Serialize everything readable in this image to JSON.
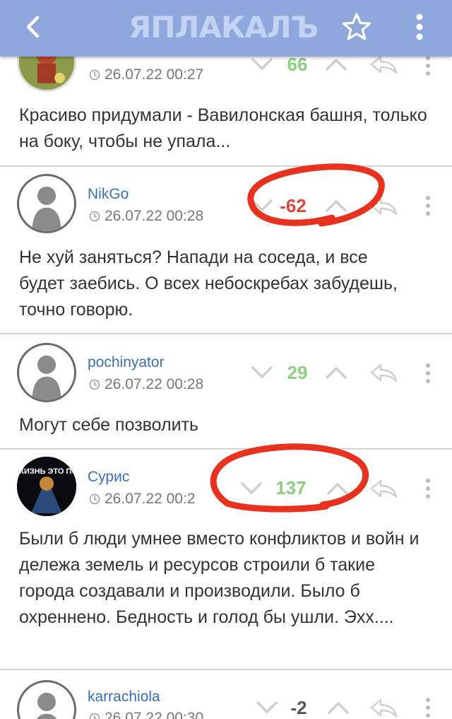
{
  "header": {
    "logo": "ЯПЛАКАЛЪ",
    "back_icon": "back-chevron-icon",
    "star_icon": "star-icon",
    "menu_icon": "more-vertical-icon",
    "bg_color": "#8ea8dd"
  },
  "comments": [
    {
      "author": "",
      "time": "26.07.22 00:27",
      "score": "66",
      "score_color": "#8ccf7e",
      "text": "Красиво придумали - Вавилонская башня, только на боку, чтобы не упала..."
    },
    {
      "author": "NikGo",
      "time": "26.07.22 00:28",
      "score": "-62",
      "score_color": "#d9463a",
      "text": "Не хуй заняться? Напади на соседа, и все будет заебись. О всех небоскребах забудешь, точно говорю."
    },
    {
      "author": "pochinyator",
      "time": "26.07.22 00:28",
      "score": "29",
      "score_color": "#8ccf7e",
      "text": "Могут себе позволить"
    },
    {
      "author": "Сурис",
      "time": "26.07.22 00:2",
      "score": "137",
      "score_color": "#8ccf7e",
      "avatar_text": "ЖИЗНЬ ЭТО ПОЕЗД",
      "text": "Были б люди умнее вместо конфликтов и войн и дележа земель и ресурсов строили б такие города создавали и производили. Было б охреннено. Бедность и голод бы ушли. Эхх...."
    },
    {
      "author": "karrachiola",
      "time": "26.07.22 00:30",
      "score": "-2",
      "score_color": "#555555",
      "text": ""
    }
  ]
}
